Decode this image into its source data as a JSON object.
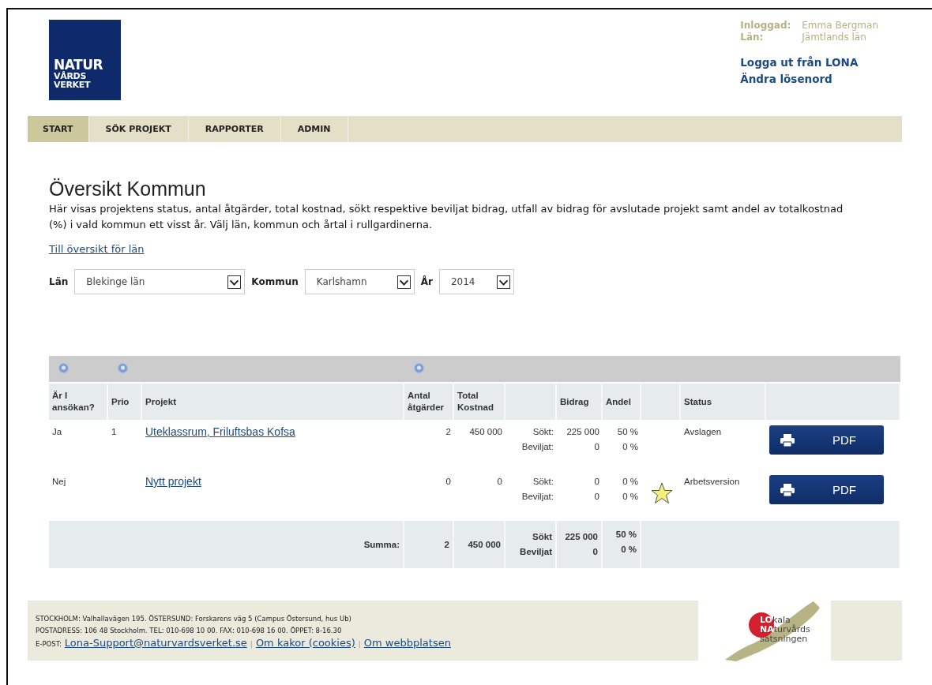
{
  "logo": {
    "lines": [
      "NATUR",
      "VÅRDS",
      "VERKET"
    ]
  },
  "user": {
    "rows": [
      {
        "label": "Inloggad:",
        "value": "Emma Bergman"
      },
      {
        "label": "Län:",
        "value": "Jämtlands län"
      }
    ],
    "links": [
      "Logga ut från LONA",
      "Ändra lösenord"
    ]
  },
  "nav": [
    {
      "label": "START",
      "selected": true
    },
    {
      "label": "SÖK PROJEKT",
      "selected": false
    },
    {
      "label": "RAPPORTER",
      "selected": false
    },
    {
      "label": "ADMIN",
      "selected": false
    }
  ],
  "title": "Översikt Kommun",
  "intro": "Här visas projektens status, antal åtgärder, total kostnad, sökt respektive beviljat bidrag, utfall av bidrag för avslutade projekt samt andel av totalkostnad (%) i vald kommun ett visst år. Välj län, kommun och årtal i rullgardinerna.",
  "overview_link": "Till översikt för län",
  "filters": [
    {
      "label": "Län",
      "value": "Blekinge län"
    },
    {
      "label": "Kommun",
      "value": "Karlshamn"
    },
    {
      "label": "År",
      "value": "2014"
    }
  ],
  "table": {
    "columns": [
      {
        "label": "Är I ansökan?",
        "info": true
      },
      {
        "label": "Prio",
        "info": true
      },
      {
        "label": "Projekt",
        "info": false
      },
      {
        "label": "Antal åtgärder",
        "info": true
      },
      {
        "label": "Total Kostnad",
        "info": false
      },
      {
        "info": false
      },
      {
        "label": "Bidrag",
        "info": false
      },
      {
        "label": "Andel",
        "info": false
      },
      {
        "info": false
      },
      {
        "label": "Status",
        "info": false
      },
      {
        "info": false
      }
    ],
    "rows": [
      {
        "in_application": "Ja",
        "prio": "1",
        "project": "Uteklassrum, Friluftsbas Kofsa",
        "measures": "2",
        "total_cost": "450 000",
        "grant_labels": [
          "Sökt:",
          "Beviljat:"
        ],
        "grants": [
          "225 000",
          "0"
        ],
        "shares": [
          "50 %",
          "0 %"
        ],
        "starred": false,
        "status": "Avslagen",
        "pdf": "PDF"
      },
      {
        "in_application": "Nej",
        "prio": "",
        "project": "Nytt projekt",
        "measures": "0",
        "total_cost": "0",
        "grant_labels": [
          "Sökt:",
          "Beviljat:"
        ],
        "grants": [
          "0",
          "0"
        ],
        "shares": [
          "0 %",
          "0 %"
        ],
        "starred": true,
        "status": "Arbetsversion",
        "pdf": "PDF"
      }
    ],
    "summary": {
      "label": "Summa:",
      "measures": "2",
      "total_cost": "450 000",
      "grant_labels": [
        "Sökt",
        "Beviljat"
      ],
      "grants": [
        "225 000",
        "0"
      ],
      "shares": [
        "50 %",
        "0 %"
      ]
    }
  },
  "footer": {
    "lines": [
      "STOCKHOLM: Valhallavägen 195. ÖSTERSUND: Forskarens väg 5 (Campus Östersund, hus Ub)",
      "POSTADRESS: 106 48 Stockholm. TEL: 010-698 10 00. FAX: 010-698 16 00. ÖPPET: 8-16.30"
    ],
    "email_label": "E-POST:",
    "links": [
      "Lona-Support@naturvardsverket.se",
      "Om kakor (cookies)",
      "Om webbplatsen"
    ],
    "separator": "|"
  },
  "lona_logo": {
    "lines": [
      {
        "mark": "LO",
        "rest": "kala"
      },
      {
        "mark": "NA",
        "rest": "turvårds"
      },
      {
        "rest": "satsningen"
      }
    ]
  }
}
